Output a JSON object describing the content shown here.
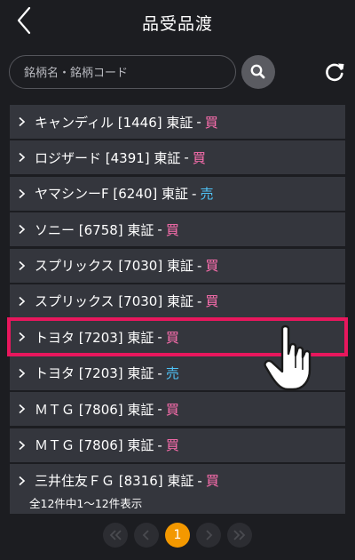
{
  "header": {
    "title": "品受品渡",
    "back_icon": "chevron-left-icon"
  },
  "search": {
    "placeholder": "銘柄名・銘柄コード",
    "value": "",
    "search_icon": "search-icon",
    "refresh_icon": "refresh-icon"
  },
  "colors": {
    "buy": "#ff6fb0",
    "sell": "#4fc3f7",
    "highlight": "#e8175d",
    "current_page": "#f39800"
  },
  "rows": [
    {
      "label": "キャンディル [1446] 東証",
      "sep": "-",
      "side": "買"
    },
    {
      "label": "ロジザード [4391] 東証",
      "sep": "-",
      "side": "買"
    },
    {
      "label": "ヤマシンーF [6240] 東証",
      "sep": "-",
      "side": "売"
    },
    {
      "label": "ソニー [6758] 東証",
      "sep": "-",
      "side": "買"
    },
    {
      "label": "スプリックス [7030] 東証",
      "sep": "-",
      "side": "買"
    },
    {
      "label": "スプリックス [7030] 東証",
      "sep": "-",
      "side": "買"
    },
    {
      "label": "トヨタ [7203] 東証",
      "sep": "-",
      "side": "買"
    },
    {
      "label": "トヨタ [7203] 東証",
      "sep": "-",
      "side": "売"
    },
    {
      "label": "ＭＴＧ [7806] 東証",
      "sep": "-",
      "side": "買"
    },
    {
      "label": "ＭＴＧ [7806] 東証",
      "sep": "-",
      "side": "買"
    },
    {
      "label": "三井住友ＦＧ [8316] 東証",
      "sep": "-",
      "side": "買"
    }
  ],
  "summary": "全12件中1～12件表示",
  "pagination": {
    "current_page": "1",
    "first_icon": "double-chevron-left-icon",
    "prev_icon": "chevron-left-icon",
    "next_icon": "chevron-right-icon",
    "last_icon": "double-chevron-right-icon"
  },
  "pointer_icon": "pointing-hand-icon"
}
